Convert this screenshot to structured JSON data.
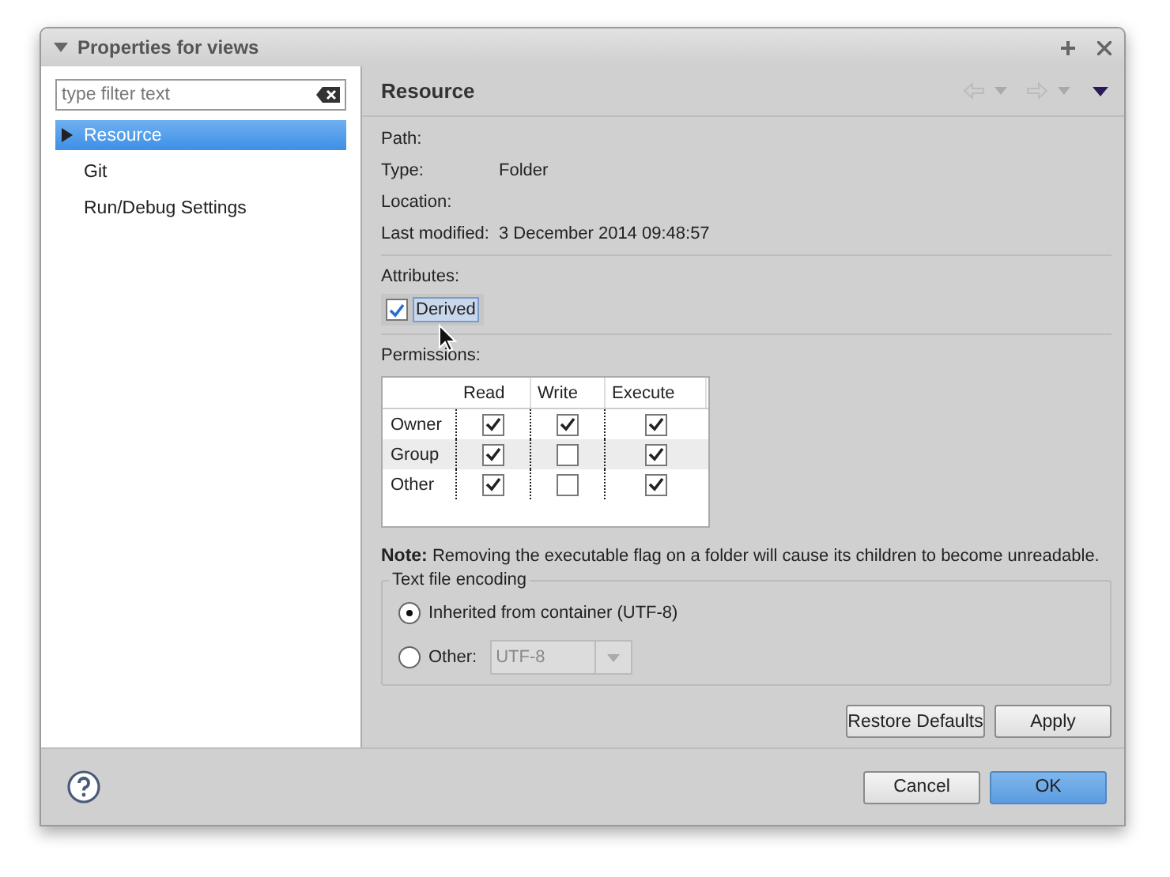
{
  "window": {
    "title": "Properties for views"
  },
  "filter": {
    "placeholder": "type filter text"
  },
  "nav_items": [
    {
      "label": "Resource",
      "selected": true
    },
    {
      "label": "Git",
      "selected": false
    },
    {
      "label": "Run/Debug Settings",
      "selected": false
    }
  ],
  "page": {
    "title": "Resource",
    "details": [
      {
        "label": "Path:"
      },
      {
        "label": "Type:",
        "value": "Folder"
      },
      {
        "label": "Location:"
      },
      {
        "label": "Last modified:",
        "value": "3 December 2014 09:48:57"
      }
    ],
    "attributes_label": "Attributes:",
    "derived": {
      "label": "Derived",
      "checked": true
    },
    "permissions_label": "Permissions:",
    "permissions": {
      "columns": [
        "Read",
        "Write",
        "Execute"
      ],
      "rows": [
        {
          "name": "Owner",
          "values": [
            true,
            true,
            true
          ]
        },
        {
          "name": "Group",
          "values": [
            true,
            false,
            true
          ]
        },
        {
          "name": "Other",
          "values": [
            true,
            false,
            true
          ]
        }
      ]
    },
    "note": "**Note:** Removing the executable flag on a folder will cause its children to become unreadable.",
    "encoding": {
      "title": "Text file encoding",
      "options": [
        {
          "label": "Inherited from container (UTF-8)",
          "selected": true
        },
        {
          "label": "Other:",
          "selected": false
        }
      ],
      "other_value": "UTF-8"
    },
    "buttons": [
      "Restore Defaults",
      "Apply"
    ]
  },
  "footer_buttons": [
    {
      "label": "Cancel",
      "default": false
    },
    {
      "label": "OK",
      "default": true
    }
  ]
}
